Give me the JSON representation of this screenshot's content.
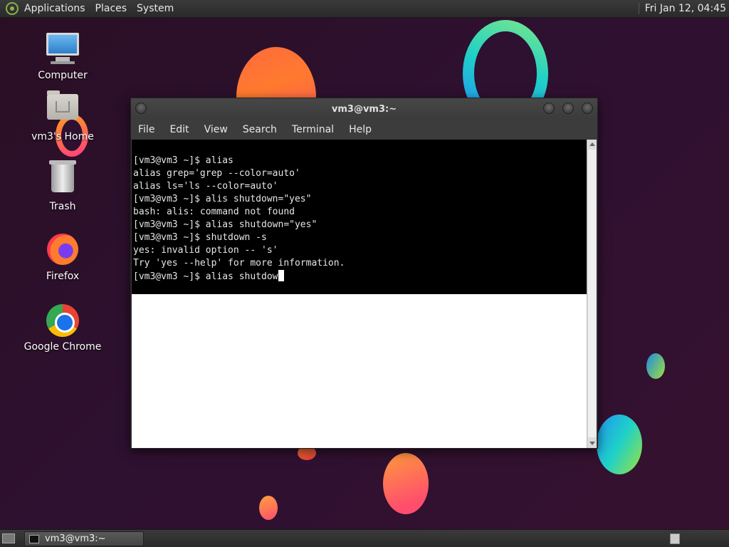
{
  "top_panel": {
    "menus": [
      "Applications",
      "Places",
      "System"
    ],
    "clock": "Fri Jan 12, 04:45"
  },
  "desktop_icons": [
    {
      "label": "Computer",
      "icon": "computer-icon"
    },
    {
      "label": "vm3's Home",
      "icon": "home-folder-icon"
    },
    {
      "label": "Trash",
      "icon": "trash-icon"
    },
    {
      "label": "Firefox",
      "icon": "firefox-icon"
    },
    {
      "label": "Google Chrome",
      "icon": "chrome-icon"
    }
  ],
  "terminal": {
    "title": "vm3@vm3:~",
    "menu": [
      "File",
      "Edit",
      "View",
      "Search",
      "Terminal",
      "Help"
    ],
    "lines": [
      "[vm3@vm3 ~]$ alias",
      "alias grep='grep --color=auto'",
      "alias ls='ls --color=auto'",
      "[vm3@vm3 ~]$ alis shutdown=\"yes\"",
      "bash: alis: command not found",
      "[vm3@vm3 ~]$ alias shutdown=\"yes\"",
      "[vm3@vm3 ~]$ shutdown -s",
      "yes: invalid option -- 's'",
      "Try 'yes --help' for more information."
    ],
    "current_input": "[vm3@vm3 ~]$ alias shutdow"
  },
  "taskbar": {
    "task_label": "vm3@vm3:~"
  }
}
